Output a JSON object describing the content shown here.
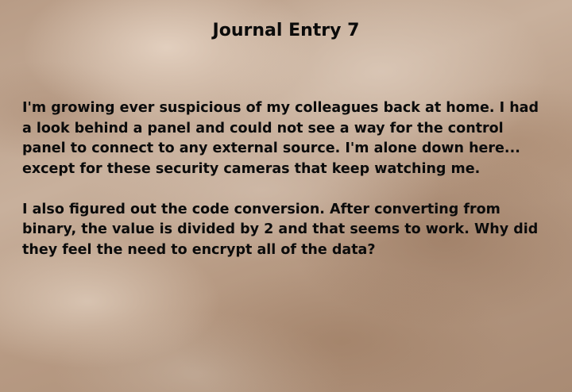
{
  "journal": {
    "title": "Journal Entry 7",
    "paragraphs": [
      "I'm growing ever suspicious of my colleagues back at home. I had\na look behind a panel and could not see a way for the control\npanel to connect to any external source. I'm alone down here...\nexcept for these security cameras that keep watching me.",
      "I also figured out the code conversion. After converting from\nbinary, the value is divided by 2 and that seems to work. Why did\nthey feel the need to encrypt all of the data?"
    ]
  }
}
